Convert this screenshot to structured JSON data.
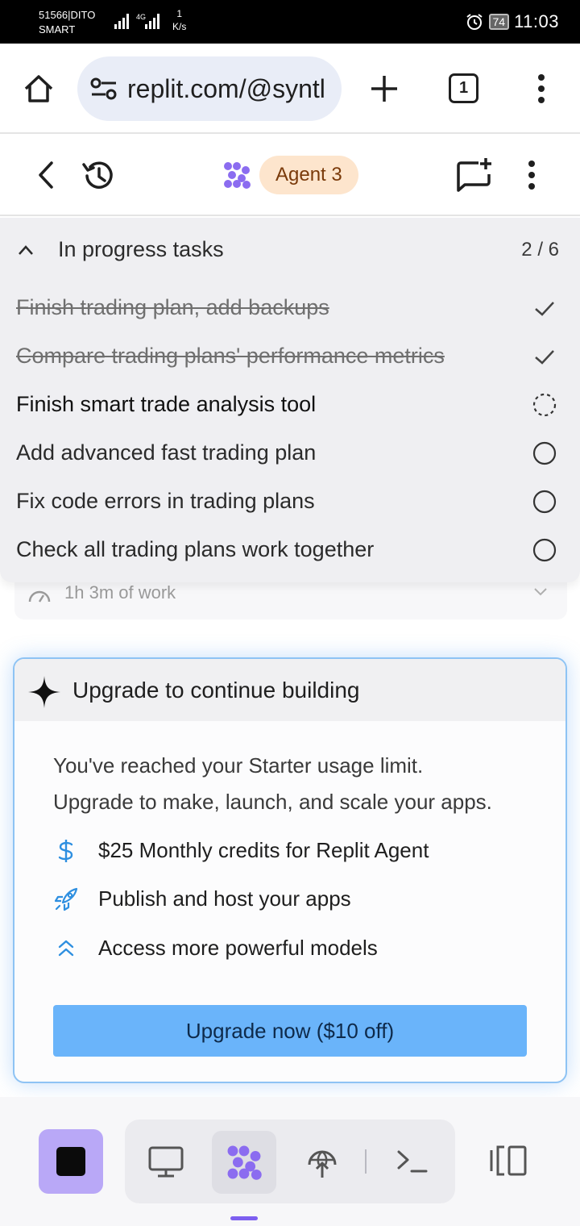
{
  "status_bar": {
    "carrier_line1": "51566|DITO",
    "carrier_line2": "SMART",
    "network": "4G",
    "speed_value": "1",
    "speed_unit": "K/s",
    "battery": "74",
    "time": "11:03"
  },
  "browser": {
    "url": "replit.com/@syntl",
    "tab_count": "1"
  },
  "app_header": {
    "agent_badge": "Agent 3"
  },
  "tasks": {
    "title": "In progress tasks",
    "progress": "2 / 6",
    "items": [
      {
        "label": "Finish trading plan, add backups",
        "status": "done"
      },
      {
        "label": "Compare trading plans' performance metrics",
        "status": "done"
      },
      {
        "label": "Finish smart trade analysis tool",
        "status": "in_progress"
      },
      {
        "label": "Add advanced fast trading plan",
        "status": "pending"
      },
      {
        "label": "Fix code errors in trading plans",
        "status": "pending"
      },
      {
        "label": "Check all trading plans work together",
        "status": "pending"
      }
    ]
  },
  "work_row": {
    "text": "1h 3m of work"
  },
  "upgrade": {
    "title": "Upgrade to continue building",
    "message_line1": "You've reached your Starter usage limit.",
    "message_line2": "Upgrade to make, launch, and scale your apps.",
    "features": [
      {
        "icon": "dollar-icon",
        "text": "$25 Monthly credits for Replit Agent"
      },
      {
        "icon": "rocket-icon",
        "text": "Publish and host your apps"
      },
      {
        "icon": "double-chevron-up-icon",
        "text": "Access more powerful models"
      }
    ],
    "button_label": "Upgrade now ($10 off)"
  },
  "colors": {
    "accent_blue": "#6ab4fa",
    "agent_purple": "#8b6cf0",
    "badge_bg": "#fde5cd",
    "stop_bg": "#b9a8f7"
  }
}
